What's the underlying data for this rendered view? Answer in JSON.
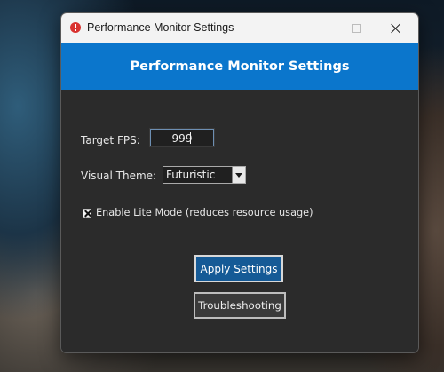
{
  "window": {
    "title": "Performance Monitor Settings",
    "header": "Performance Monitor Settings"
  },
  "titlebar": {
    "app_icon": "alert-circle-icon",
    "controls": [
      "minimize-icon",
      "maximize-icon",
      "close-icon"
    ]
  },
  "form": {
    "fps_label": "Target FPS:",
    "fps_value": "999",
    "theme_label": "Visual Theme:",
    "theme_value": "Futuristic",
    "lite_mode_label": "Enable Lite Mode (reduces resource usage)",
    "lite_mode_checked": true
  },
  "buttons": {
    "apply": "Apply Settings",
    "troubleshoot": "Troubleshooting"
  },
  "colors": {
    "header_bg": "#0b76cc",
    "apply_bg": "#155a96",
    "window_bg": "#2b2b2b"
  }
}
